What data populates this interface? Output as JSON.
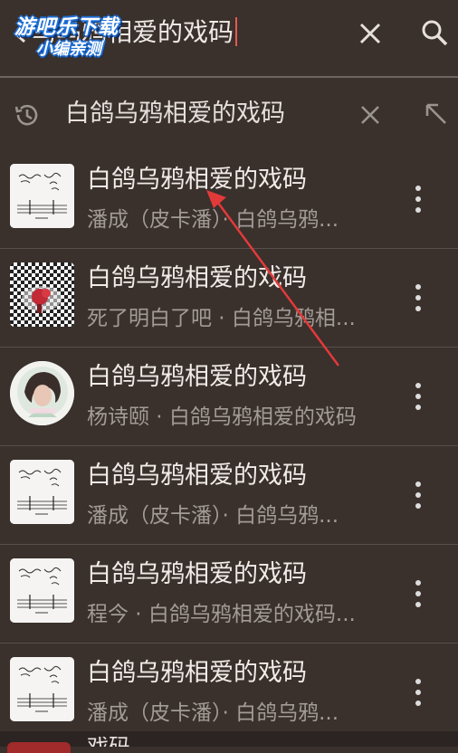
{
  "search": {
    "query": "白鸽乌鸦相爱的戏码",
    "visible_query": "鸟乌鸦相爱的戏码"
  },
  "watermark": {
    "line1": "游吧乐下载",
    "line2": "小编亲测"
  },
  "history": {
    "text": "白鸽乌鸦相爱的戏码"
  },
  "results": [
    {
      "title": "白鸽乌鸦相爱的戏码",
      "subtitle": "潘成（皮卡潘）· 白鸽乌鸦...",
      "cover": "sheet-music"
    },
    {
      "title": "白鸽乌鸦相爱的戏码",
      "subtitle": "死了明白了吧 · 白鸽乌鸦相...",
      "cover": "checkered"
    },
    {
      "title": "白鸽乌鸦相爱的戏码",
      "subtitle": "杨诗颐 · 白鸽乌鸦相爱的戏码",
      "cover": "portrait"
    },
    {
      "title": "白鸽乌鸦相爱的戏码",
      "subtitle": "潘成（皮卡潘）· 白鸽乌鸦...",
      "cover": "sheet-music"
    },
    {
      "title": "白鸽乌鸦相爱的戏码",
      "subtitle": "程今 · 白鸽乌鸦相爱的戏码...",
      "cover": "sheet-music"
    },
    {
      "title": "白鸽乌鸦相爱的戏码",
      "subtitle": "潘成（皮卡潘）· 白鸽乌鸦...",
      "cover": "sheet-music"
    }
  ],
  "peek": {
    "title": "戏码"
  },
  "colors": {
    "background": "#3a302c",
    "caret": "#e35b4f",
    "annotation_arrow": "#e23a3a"
  },
  "icons": [
    "back-arrow-icon",
    "clear-icon",
    "search-icon",
    "history-icon",
    "close-icon",
    "fill-arrow-icon",
    "more-vertical-icon"
  ]
}
